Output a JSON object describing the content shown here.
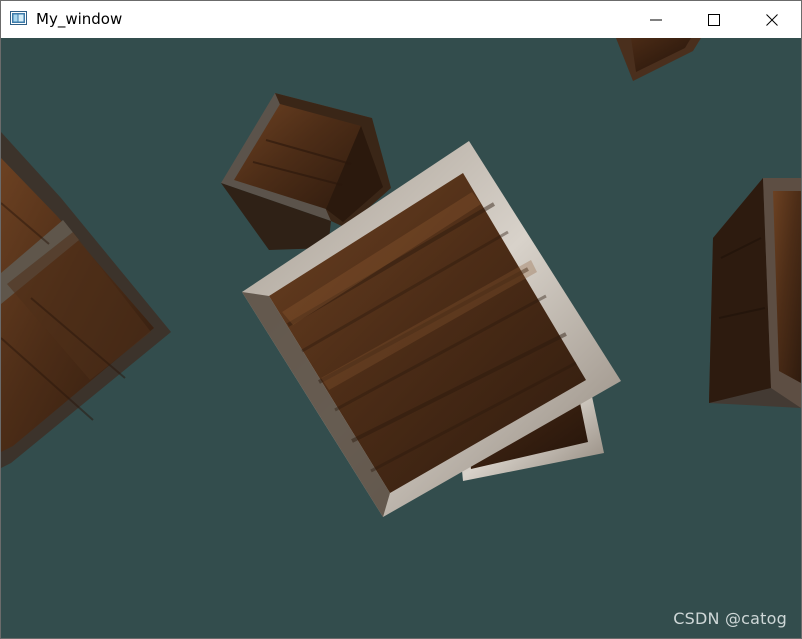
{
  "window": {
    "title": "My_window",
    "icon": "app-window-icon",
    "controls": {
      "minimize_icon": "minimize-icon",
      "maximize_icon": "maximize-icon",
      "close_icon": "close-icon"
    }
  },
  "viewport": {
    "clear_color": "#334d4d",
    "object": "textured wooden crates"
  },
  "watermark": {
    "text": "CSDN @catog"
  },
  "colors": {
    "wood_dark": "#3a2313",
    "wood_mid": "#5b371e",
    "wood_light": "#7a4f2d",
    "metal_edge": "#8b7e70",
    "metal_light": "#d9d4cc"
  }
}
